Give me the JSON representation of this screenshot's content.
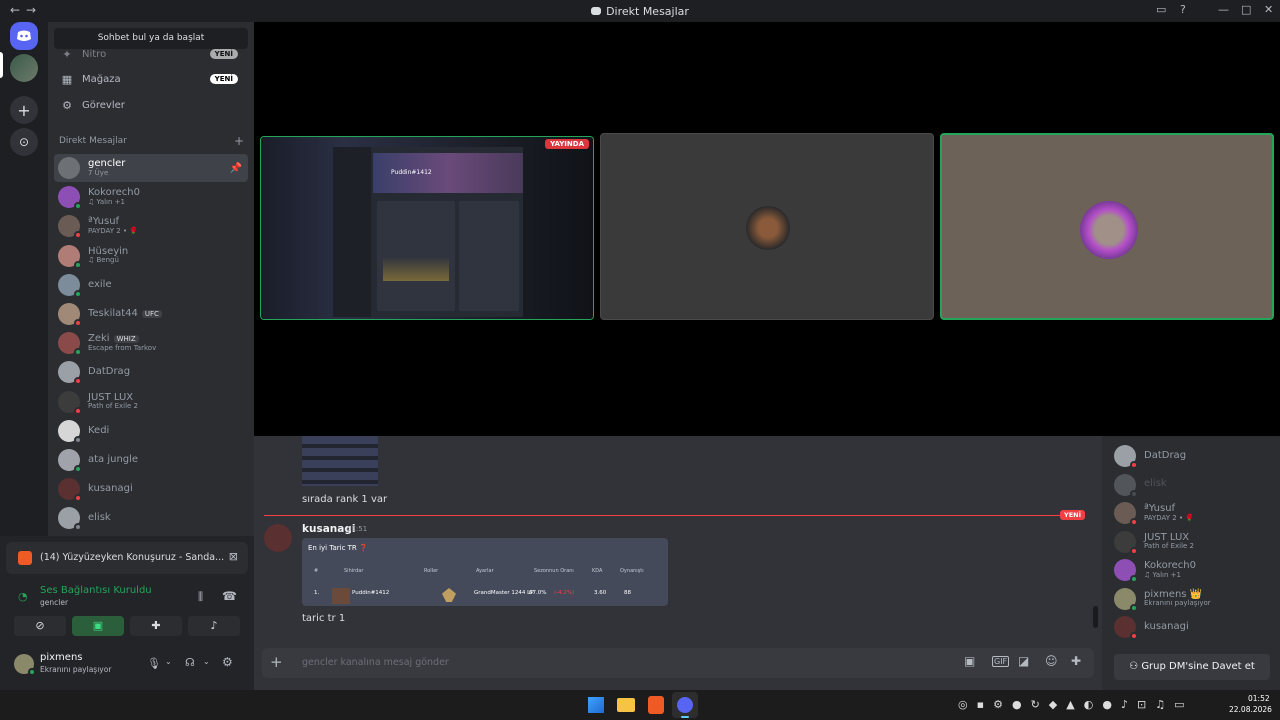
{
  "window": {
    "title": "Direkt Mesajlar"
  },
  "sidebar": {
    "search_placeholder": "Sohbet bul ya da başlat",
    "nav": [
      {
        "label": "Nitro",
        "badge": "YENİ",
        "icon": "nitro-icon"
      },
      {
        "label": "Mağaza",
        "badge": "YENİ",
        "icon": "shop-icon"
      },
      {
        "label": "Görevler",
        "badge": "",
        "icon": "quests-icon"
      }
    ],
    "dm_header": "Direkt Mesajlar",
    "dms": [
      {
        "name": "gencler",
        "sub": "7 Üye",
        "active": true,
        "color": "#6d7075",
        "status": ""
      },
      {
        "name": "Kokorech0",
        "sub": "♫ Yalın +1",
        "color": "#8e4fb5",
        "status": "#23a55a"
      },
      {
        "name": "ªYusuf",
        "sub": "PAYDAY 2 • 🌹",
        "color": "#6a5c55",
        "status": "#f23f43"
      },
      {
        "name": "Hüseyin",
        "sub": "♫ Bengü",
        "color": "#b07d76",
        "status": "#23a55a"
      },
      {
        "name": "exile",
        "sub": "",
        "color": "#7c8c9a",
        "status": "#23a55a"
      },
      {
        "name": "Teskilat44",
        "sub": "",
        "tag": "UFC",
        "color": "#a08a77",
        "status": "#f23f43"
      },
      {
        "name": "Zeki",
        "sub": "Escape from Tarkov",
        "tag": "WHIZ",
        "color": "#8a4a4a",
        "status": "#23a55a"
      },
      {
        "name": "DatDrag",
        "sub": "",
        "color": "#9aa0a6",
        "status": "#f23f43"
      },
      {
        "name": "JUST LUX",
        "sub": "Path of Exile 2",
        "color": "#3c3c3c",
        "status": "#f23f43"
      },
      {
        "name": "Kedi",
        "sub": "",
        "color": "#d6d6d6",
        "status": "#80848e"
      },
      {
        "name": "ata jungle",
        "sub": "",
        "color": "#a0a4aa",
        "status": "#23a55a"
      },
      {
        "name": "kusanagi",
        "sub": "",
        "color": "#5a3030",
        "status": "#f23f43"
      },
      {
        "name": "elisk",
        "sub": "",
        "color": "#9aa0a6",
        "status": "#80848e"
      }
    ]
  },
  "voice": {
    "media": "(14) Yüzyüzeyken Konuşuruz - Sanda...",
    "status": "Ses Bağlantısı Kuruldu",
    "channel": "gencler",
    "user": "pixmens",
    "user_status": "Ekranını paylaşıyor"
  },
  "stream": {
    "live_badge": "YAYINDA",
    "preview_name": "Puddin#1412"
  },
  "chat": {
    "prev_text": "sırada rank 1 var",
    "new_badge": "YENİ",
    "author": "kusanagi",
    "time": "01:51",
    "embed_title": "En iyi Taric TR ❓",
    "embed_headers": [
      "#",
      "Sihirdar",
      "Roller",
      "Ayarlar",
      "Sezonnun Oranı",
      "KDA",
      "Oynanıştı"
    ],
    "embed_row": [
      "1.",
      "Puddin#1412",
      "GrandMaster 1244 LP",
      "67.0%",
      "(-4.2%)",
      "3.60",
      "88"
    ],
    "msg_text": "taric tr 1",
    "input_placeholder": "gencler kanalına mesaj gönder"
  },
  "members": {
    "list": [
      {
        "name": "DatDrag",
        "sub": "",
        "color": "#9aa0a6",
        "status": "#f23f43",
        "dim": false
      },
      {
        "name": "elisk",
        "sub": "",
        "color": "#9aa0a6",
        "status": "#80848e",
        "dim": true
      },
      {
        "name": "ªYusuf",
        "sub": "PAYDAY 2 • 🌹",
        "color": "#6a5c55",
        "status": "#f23f43",
        "dim": false
      },
      {
        "name": "JUST LUX",
        "sub": "Path of Exile 2",
        "color": "#3c3c3c",
        "status": "#f23f43",
        "dim": false
      },
      {
        "name": "Kokorech0",
        "sub": "♫ Yalın +1",
        "color": "#8e4fb5",
        "status": "#23a55a",
        "dim": false
      },
      {
        "name": "pixmens 👑",
        "sub": "Ekranını paylaşıyor",
        "color": "#8a8a6a",
        "status": "#23a55a",
        "dim": false
      },
      {
        "name": "kusanagi",
        "sub": "",
        "color": "#5a3030",
        "status": "#f23f43",
        "dim": false
      }
    ],
    "invite_label": "Grup DM'sine Davet et"
  },
  "taskbar": {
    "time": "01:52",
    "date": "22.08.2026"
  }
}
